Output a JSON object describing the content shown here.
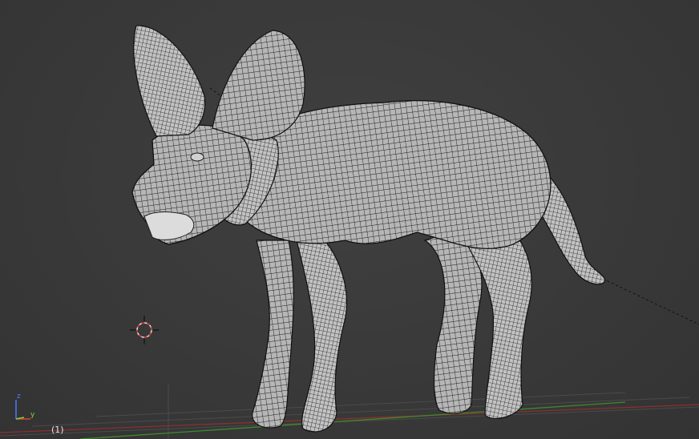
{
  "viewport": {
    "frame_indicator": "(1)",
    "object": "fennec-fox-mesh",
    "shading": "wireframe-over-solid"
  },
  "axes_gizmo": {
    "z_label": "z",
    "y_label": "y",
    "colors": {
      "x": "#e04040",
      "y": "#7fd43a",
      "z": "#4a7bff"
    }
  },
  "colors": {
    "background": "#3a3a3a",
    "mesh_fill": "#b8b8b8",
    "wire": "#1c1c1c",
    "grid": "#4a4a4a"
  }
}
